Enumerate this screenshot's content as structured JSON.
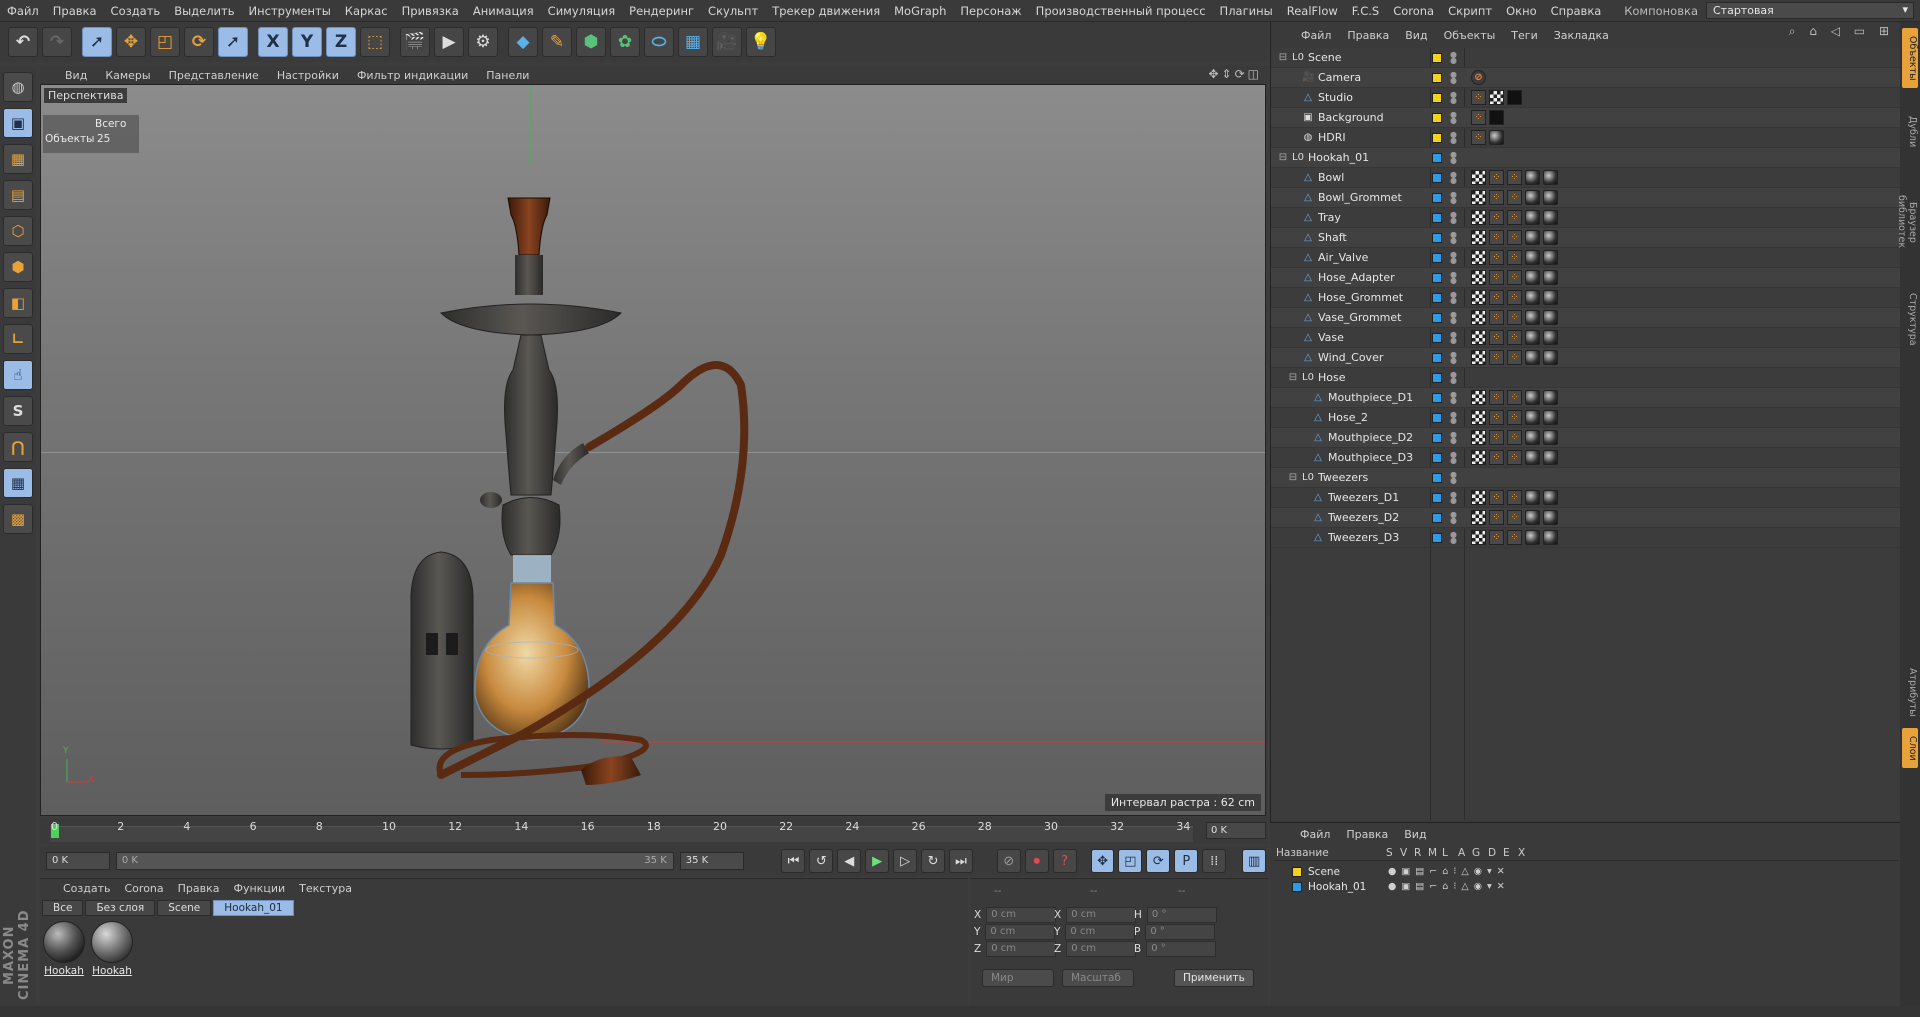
{
  "menu": [
    "Файл",
    "Правка",
    "Создать",
    "Выделить",
    "Инструменты",
    "Каркас",
    "Привязка",
    "Анимация",
    "Симуляция",
    "Рендеринг",
    "Скульпт",
    "Трекер движения",
    "MoGraph",
    "Персонаж",
    "Производственный процесс",
    "Плагины",
    "RealFlow",
    "F.C.S",
    "Corona",
    "Скрипт",
    "Окно",
    "Справка"
  ],
  "layout": {
    "label": "Компоновка",
    "value": "Стартовая"
  },
  "toolbar_icons": [
    "undo-icon",
    "redo-icon",
    "select-icon",
    "move-icon",
    "scale-icon",
    "rotate-icon",
    "live-select-icon",
    "x-axis-icon",
    "y-axis-icon",
    "z-axis-icon",
    "coord-system-icon",
    "render-view-icon",
    "render-picture-icon",
    "render-settings-icon",
    "cube-icon",
    "pen-icon",
    "subdivision-icon",
    "cloner-icon",
    "deformer-icon",
    "floor-icon",
    "camera-icon",
    "light-icon"
  ],
  "axis_letters": {
    "x": "X",
    "y": "Y",
    "z": "Z"
  },
  "viewport": {
    "menu": [
      "Вид",
      "Камеры",
      "Представление",
      "Настройки",
      "Фильтр индикации",
      "Панели"
    ],
    "label": "Перспектива",
    "stats_header": "Всего",
    "stats_label": "Объекты",
    "stats_value": "25",
    "interval": "Интервал растра : 62 cm",
    "axis_x": "X",
    "axis_y": "Y"
  },
  "timeline": {
    "ticks": [
      "0",
      "2",
      "4",
      "6",
      "8",
      "10",
      "12",
      "14",
      "16",
      "18",
      "20",
      "22",
      "24",
      "26",
      "28",
      "30",
      "32",
      "34"
    ],
    "current_frame": "0 K",
    "start": "0 K",
    "range_start": "0 K",
    "range_end": "35 K",
    "end": "35 K"
  },
  "materials": {
    "menu": [
      "Создать",
      "Corona",
      "Правка",
      "Функции",
      "Текстура"
    ],
    "tabs": [
      "Все",
      "Без слоя",
      "Scene",
      "Hookah_01"
    ],
    "items": [
      "Hookah",
      "Hookah"
    ]
  },
  "coords": {
    "header": [
      "--",
      "--",
      "--"
    ],
    "rows": [
      {
        "a": "X",
        "av": "0 cm",
        "b": "X",
        "bv": "0 cm",
        "c": "H",
        "cv": "0 °"
      },
      {
        "a": "Y",
        "av": "0 cm",
        "b": "Y",
        "bv": "0 cm",
        "c": "P",
        "cv": "0 °"
      },
      {
        "a": "Z",
        "av": "0 cm",
        "b": "Z",
        "bv": "0 cm",
        "c": "B",
        "cv": "0 °"
      }
    ],
    "mode1": "Мир",
    "mode2": "Масштаб",
    "apply": "Применить"
  },
  "objects": {
    "menu": [
      "Файл",
      "Правка",
      "Вид",
      "Объекты",
      "Теги",
      "Закладка"
    ],
    "rows": [
      {
        "name": "Scene",
        "indent": 0,
        "type": "null",
        "color": "#f2d21c",
        "tags": []
      },
      {
        "name": "Camera",
        "indent": 1,
        "type": "camera",
        "color": "#f2d21c",
        "tags": [
          "forbid"
        ]
      },
      {
        "name": "Studio",
        "indent": 1,
        "type": "poly",
        "color": "#f2d21c",
        "tags": [
          "dot",
          "check",
          "black"
        ]
      },
      {
        "name": "Background",
        "indent": 1,
        "type": "bg",
        "color": "#f2d21c",
        "tags": [
          "dot",
          "black"
        ]
      },
      {
        "name": "HDRI",
        "indent": 1,
        "type": "sky",
        "color": "#f2d21c",
        "tags": [
          "dot",
          "mat"
        ]
      },
      {
        "name": "Hookah_01",
        "indent": 0,
        "type": "null",
        "color": "#2e9be6",
        "tags": []
      },
      {
        "name": "Bowl",
        "indent": 1,
        "type": "poly",
        "color": "#2e9be6",
        "tags": [
          "check",
          "dot",
          "dot",
          "mat",
          "mat"
        ]
      },
      {
        "name": "Bowl_Grommet",
        "indent": 1,
        "type": "poly",
        "color": "#2e9be6",
        "tags": [
          "check",
          "dot",
          "dot",
          "mat",
          "mat"
        ]
      },
      {
        "name": "Tray",
        "indent": 1,
        "type": "poly",
        "color": "#2e9be6",
        "tags": [
          "check",
          "dot",
          "dot",
          "mat",
          "mat"
        ]
      },
      {
        "name": "Shaft",
        "indent": 1,
        "type": "poly",
        "color": "#2e9be6",
        "tags": [
          "check",
          "dot",
          "dot",
          "mat",
          "mat"
        ]
      },
      {
        "name": "Air_Valve",
        "indent": 1,
        "type": "poly",
        "color": "#2e9be6",
        "tags": [
          "check",
          "dot",
          "dot",
          "mat",
          "mat"
        ]
      },
      {
        "name": "Hose_Adapter",
        "indent": 1,
        "type": "poly",
        "color": "#2e9be6",
        "tags": [
          "check",
          "dot",
          "dot",
          "mat",
          "mat"
        ]
      },
      {
        "name": "Hose_Grommet",
        "indent": 1,
        "type": "poly",
        "color": "#2e9be6",
        "tags": [
          "check",
          "dot",
          "dot",
          "mat",
          "mat"
        ]
      },
      {
        "name": "Vase_Grommet",
        "indent": 1,
        "type": "poly",
        "color": "#2e9be6",
        "tags": [
          "check",
          "dot",
          "dot",
          "mat",
          "mat"
        ]
      },
      {
        "name": "Vase",
        "indent": 1,
        "type": "poly",
        "color": "#2e9be6",
        "tags": [
          "check",
          "dot",
          "dot",
          "mat",
          "mat"
        ]
      },
      {
        "name": "Wind_Cover",
        "indent": 1,
        "type": "poly",
        "color": "#2e9be6",
        "tags": [
          "check",
          "dot",
          "dot",
          "mat",
          "mat"
        ]
      },
      {
        "name": "Hose",
        "indent": 1,
        "type": "null",
        "color": "#2e9be6",
        "tags": []
      },
      {
        "name": "Mouthpiece_D1",
        "indent": 2,
        "type": "poly",
        "color": "#2e9be6",
        "tags": [
          "check",
          "dot",
          "dot",
          "mat",
          "mat"
        ]
      },
      {
        "name": "Hose_2",
        "indent": 2,
        "type": "poly",
        "color": "#2e9be6",
        "tags": [
          "check",
          "dot",
          "dot",
          "mat",
          "mat"
        ]
      },
      {
        "name": "Mouthpiece_D2",
        "indent": 2,
        "type": "poly",
        "color": "#2e9be6",
        "tags": [
          "check",
          "dot",
          "dot",
          "mat",
          "mat"
        ]
      },
      {
        "name": "Mouthpiece_D3",
        "indent": 2,
        "type": "poly",
        "color": "#2e9be6",
        "tags": [
          "check",
          "dot",
          "dot",
          "mat",
          "mat"
        ]
      },
      {
        "name": "Tweezers",
        "indent": 1,
        "type": "null",
        "color": "#2e9be6",
        "tags": []
      },
      {
        "name": "Tweezers_D1",
        "indent": 2,
        "type": "poly",
        "color": "#2e9be6",
        "tags": [
          "check",
          "dot",
          "dot",
          "mat",
          "mat"
        ]
      },
      {
        "name": "Tweezers_D2",
        "indent": 2,
        "type": "poly",
        "color": "#2e9be6",
        "tags": [
          "check",
          "dot",
          "dot",
          "mat",
          "mat"
        ]
      },
      {
        "name": "Tweezers_D3",
        "indent": 2,
        "type": "poly",
        "color": "#2e9be6",
        "tags": [
          "check",
          "dot",
          "dot",
          "mat",
          "mat"
        ]
      }
    ]
  },
  "sidetabs": [
    "Объекты",
    "Дубли",
    "Браузер библиотек",
    "Структура",
    "Атрибуты",
    "Слои"
  ],
  "layers": {
    "menu": [
      "Файл",
      "Правка",
      "Вид"
    ],
    "columns": [
      "Название",
      "S",
      "V",
      "R",
      "M",
      "L",
      "A",
      "G",
      "D",
      "E",
      "X"
    ],
    "rows": [
      {
        "name": "Scene",
        "color": "#f2d21c"
      },
      {
        "name": "Hookah_01",
        "color": "#2e9be6"
      }
    ]
  },
  "brand": "MAXON CINEMA 4D"
}
